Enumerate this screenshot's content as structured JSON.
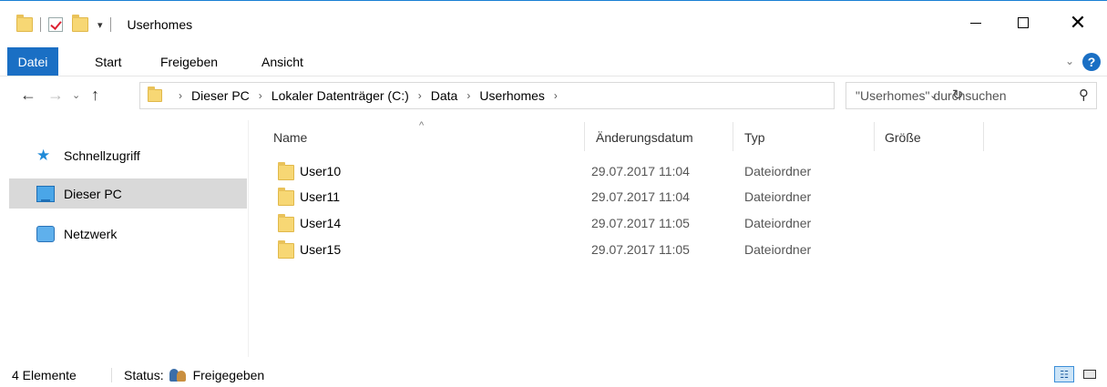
{
  "window": {
    "title": "Userhomes",
    "minimize_glyph": "–",
    "close_glyph": "✕"
  },
  "ribbon": {
    "tabs": [
      "Datei",
      "Start",
      "Freigeben",
      "Ansicht"
    ],
    "help_label": "?"
  },
  "navigation": {
    "back_glyph": "←",
    "forward_glyph": "→",
    "recent_glyph": "⌄",
    "up_glyph": "↑",
    "breadcrumb": [
      "Dieser PC",
      "Lokaler Datenträger (C:)",
      "Data",
      "Userhomes"
    ],
    "separator": "›",
    "refresh_glyph": "↻",
    "dropdown_glyph": "⌄"
  },
  "search": {
    "placeholder": "\"Userhomes\" durchsuchen",
    "icon_glyph": "⚲"
  },
  "sidebar": {
    "items": [
      {
        "label": "Schnellzugriff",
        "icon": "star-icon"
      },
      {
        "label": "Dieser PC",
        "icon": "computer-icon",
        "selected": true
      },
      {
        "label": "Netzwerk",
        "icon": "network-icon"
      }
    ]
  },
  "file_list": {
    "sort_glyph": "^",
    "columns": [
      "Name",
      "Änderungsdatum",
      "Typ",
      "Größe"
    ],
    "rows": [
      {
        "name": "User10",
        "date": "29.07.2017 11:04",
        "type": "Dateiordner"
      },
      {
        "name": "User11",
        "date": "29.07.2017 11:04",
        "type": "Dateiordner"
      },
      {
        "name": "User14",
        "date": "29.07.2017 11:05",
        "type": "Dateiordner"
      },
      {
        "name": "User15",
        "date": "29.07.2017 11:05",
        "type": "Dateiordner"
      }
    ]
  },
  "status": {
    "count": "4 Elemente",
    "status_prefix": "Status:",
    "status_value": "Freigegeben"
  },
  "colors": {
    "accent": "#1a6fc4",
    "folder": "#f7d774",
    "selection": "#d9d9d9"
  }
}
